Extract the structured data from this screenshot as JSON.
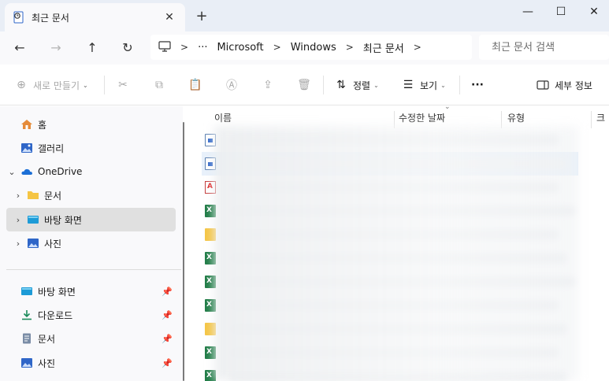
{
  "window": {
    "tab_title": "최근 문서",
    "new_tab_symbol": "+",
    "close_tab_symbol": "✕",
    "controls": {
      "minimize": "—",
      "maximize": "☐",
      "close": "✕"
    }
  },
  "navigation": {
    "back": "←",
    "forward": "→",
    "up": "↑",
    "refresh": "↻",
    "breadcrumb": [
      "Microsoft",
      "Windows",
      "최근 문서"
    ],
    "overflow": "···",
    "chevron": ">",
    "search_placeholder": "최근 문서 검색"
  },
  "commands": {
    "new": "새로 만들기",
    "sort": "정렬",
    "view": "보기",
    "more": "···",
    "details": "세부 정보"
  },
  "sidebar": {
    "items": [
      {
        "label": "홈",
        "icon": "home-icon"
      },
      {
        "label": "갤러리",
        "icon": "gallery-icon"
      },
      {
        "label": "OneDrive",
        "icon": "onedrive-cloud-icon"
      },
      {
        "label": "문서",
        "icon": "folder-icon"
      },
      {
        "label": "바탕 화면",
        "icon": "desktop-icon"
      },
      {
        "label": "사진",
        "icon": "pictures-icon"
      }
    ],
    "quick_access": [
      {
        "label": "바탕 화면",
        "icon": "desktop-icon"
      },
      {
        "label": "다운로드",
        "icon": "download-icon"
      },
      {
        "label": "문서",
        "icon": "documents-icon"
      },
      {
        "label": "사진",
        "icon": "pictures-icon"
      }
    ]
  },
  "file_list": {
    "columns": [
      "이름",
      "수정한 날짜",
      "유형",
      "크"
    ],
    "rows": [
      {
        "type": "document"
      },
      {
        "type": "document"
      },
      {
        "type": "pdf"
      },
      {
        "type": "excel"
      },
      {
        "type": "folder"
      },
      {
        "type": "excel"
      },
      {
        "type": "excel"
      },
      {
        "type": "excel"
      },
      {
        "type": "folder"
      },
      {
        "type": "excel"
      },
      {
        "type": "excel"
      }
    ]
  },
  "colors": {
    "titlebar_bg": "#e9eef6",
    "pane_bg": "#f9f9fb",
    "selected_row": "#e8f1fb",
    "accent_blue": "#2f66c8"
  }
}
